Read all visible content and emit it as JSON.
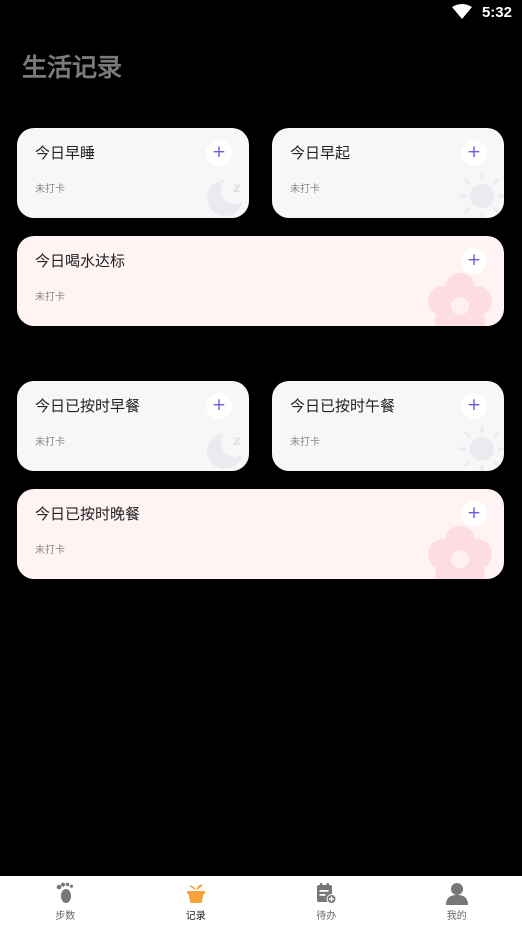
{
  "status_bar": {
    "time": "5:32"
  },
  "page": {
    "title": "生活记录"
  },
  "cards": [
    {
      "title": "今日早睡",
      "status": "未打卡",
      "plus": "+"
    },
    {
      "title": "今日早起",
      "status": "未打卡",
      "plus": "+"
    },
    {
      "title": "今日喝水达标",
      "status": "未打卡",
      "plus": "+"
    },
    {
      "title": "今日已按时早餐",
      "status": "未打卡",
      "plus": "+"
    },
    {
      "title": "今日已按时午餐",
      "status": "未打卡",
      "plus": "+"
    },
    {
      "title": "今日已按时晚餐",
      "status": "未打卡",
      "plus": "+"
    }
  ],
  "tabs": [
    {
      "label": "步数",
      "icon": "footprint-icon"
    },
    {
      "label": "记录",
      "icon": "plant-pot-icon",
      "active": true,
      "accent": "#f5a23c"
    },
    {
      "label": "待办",
      "icon": "todo-calendar-icon"
    },
    {
      "label": "我的",
      "icon": "profile-icon"
    }
  ]
}
